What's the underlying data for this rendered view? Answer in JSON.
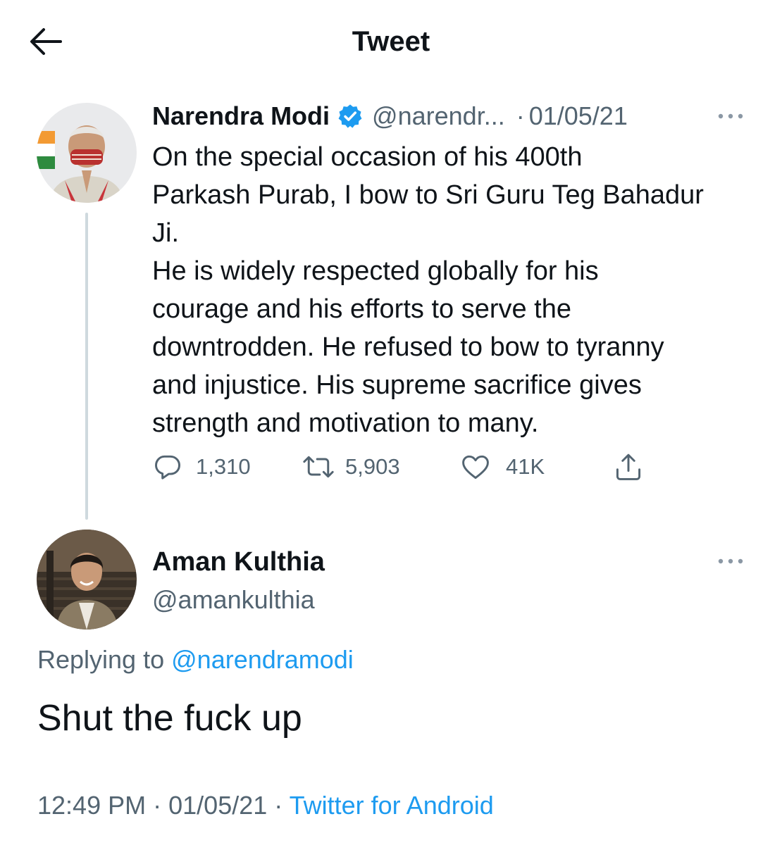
{
  "header": {
    "title": "Tweet"
  },
  "tweet": {
    "author_name": "Narendra Modi",
    "author_handle": "@narendr...",
    "dot": "·",
    "date": "01/05/21",
    "text_lines": [
      "On the special occasion of his 400th",
      "Parkash Purab, I bow to Sri Guru Teg Bahadur",
      "Ji.",
      "He is widely respected globally for his",
      "courage and his efforts to serve the",
      "downtrodden. He refused to bow to tyranny",
      "and injustice. His supreme sacrifice gives",
      "strength and motivation to many."
    ],
    "replies": "1,310",
    "retweets": "5,903",
    "likes": "41K"
  },
  "reply": {
    "author_name": "Aman Kulthia",
    "author_handle": "@amankulthia",
    "replying_label": "Replying to",
    "replying_to": "@narendramodi",
    "text": "Shut the fuck up",
    "time": "12:49 PM",
    "sep1": "·",
    "date": "01/05/21",
    "sep2": "·",
    "source": "Twitter for Android"
  },
  "colors": {
    "accent": "#1d9bf0",
    "secondary_text": "#536471",
    "primary_text": "#0f1419",
    "thread_line": "#cfd9de"
  },
  "icons": [
    "back-arrow-icon",
    "verified-badge-icon",
    "more-icon",
    "reply-icon",
    "retweet-icon",
    "like-icon",
    "share-icon"
  ]
}
